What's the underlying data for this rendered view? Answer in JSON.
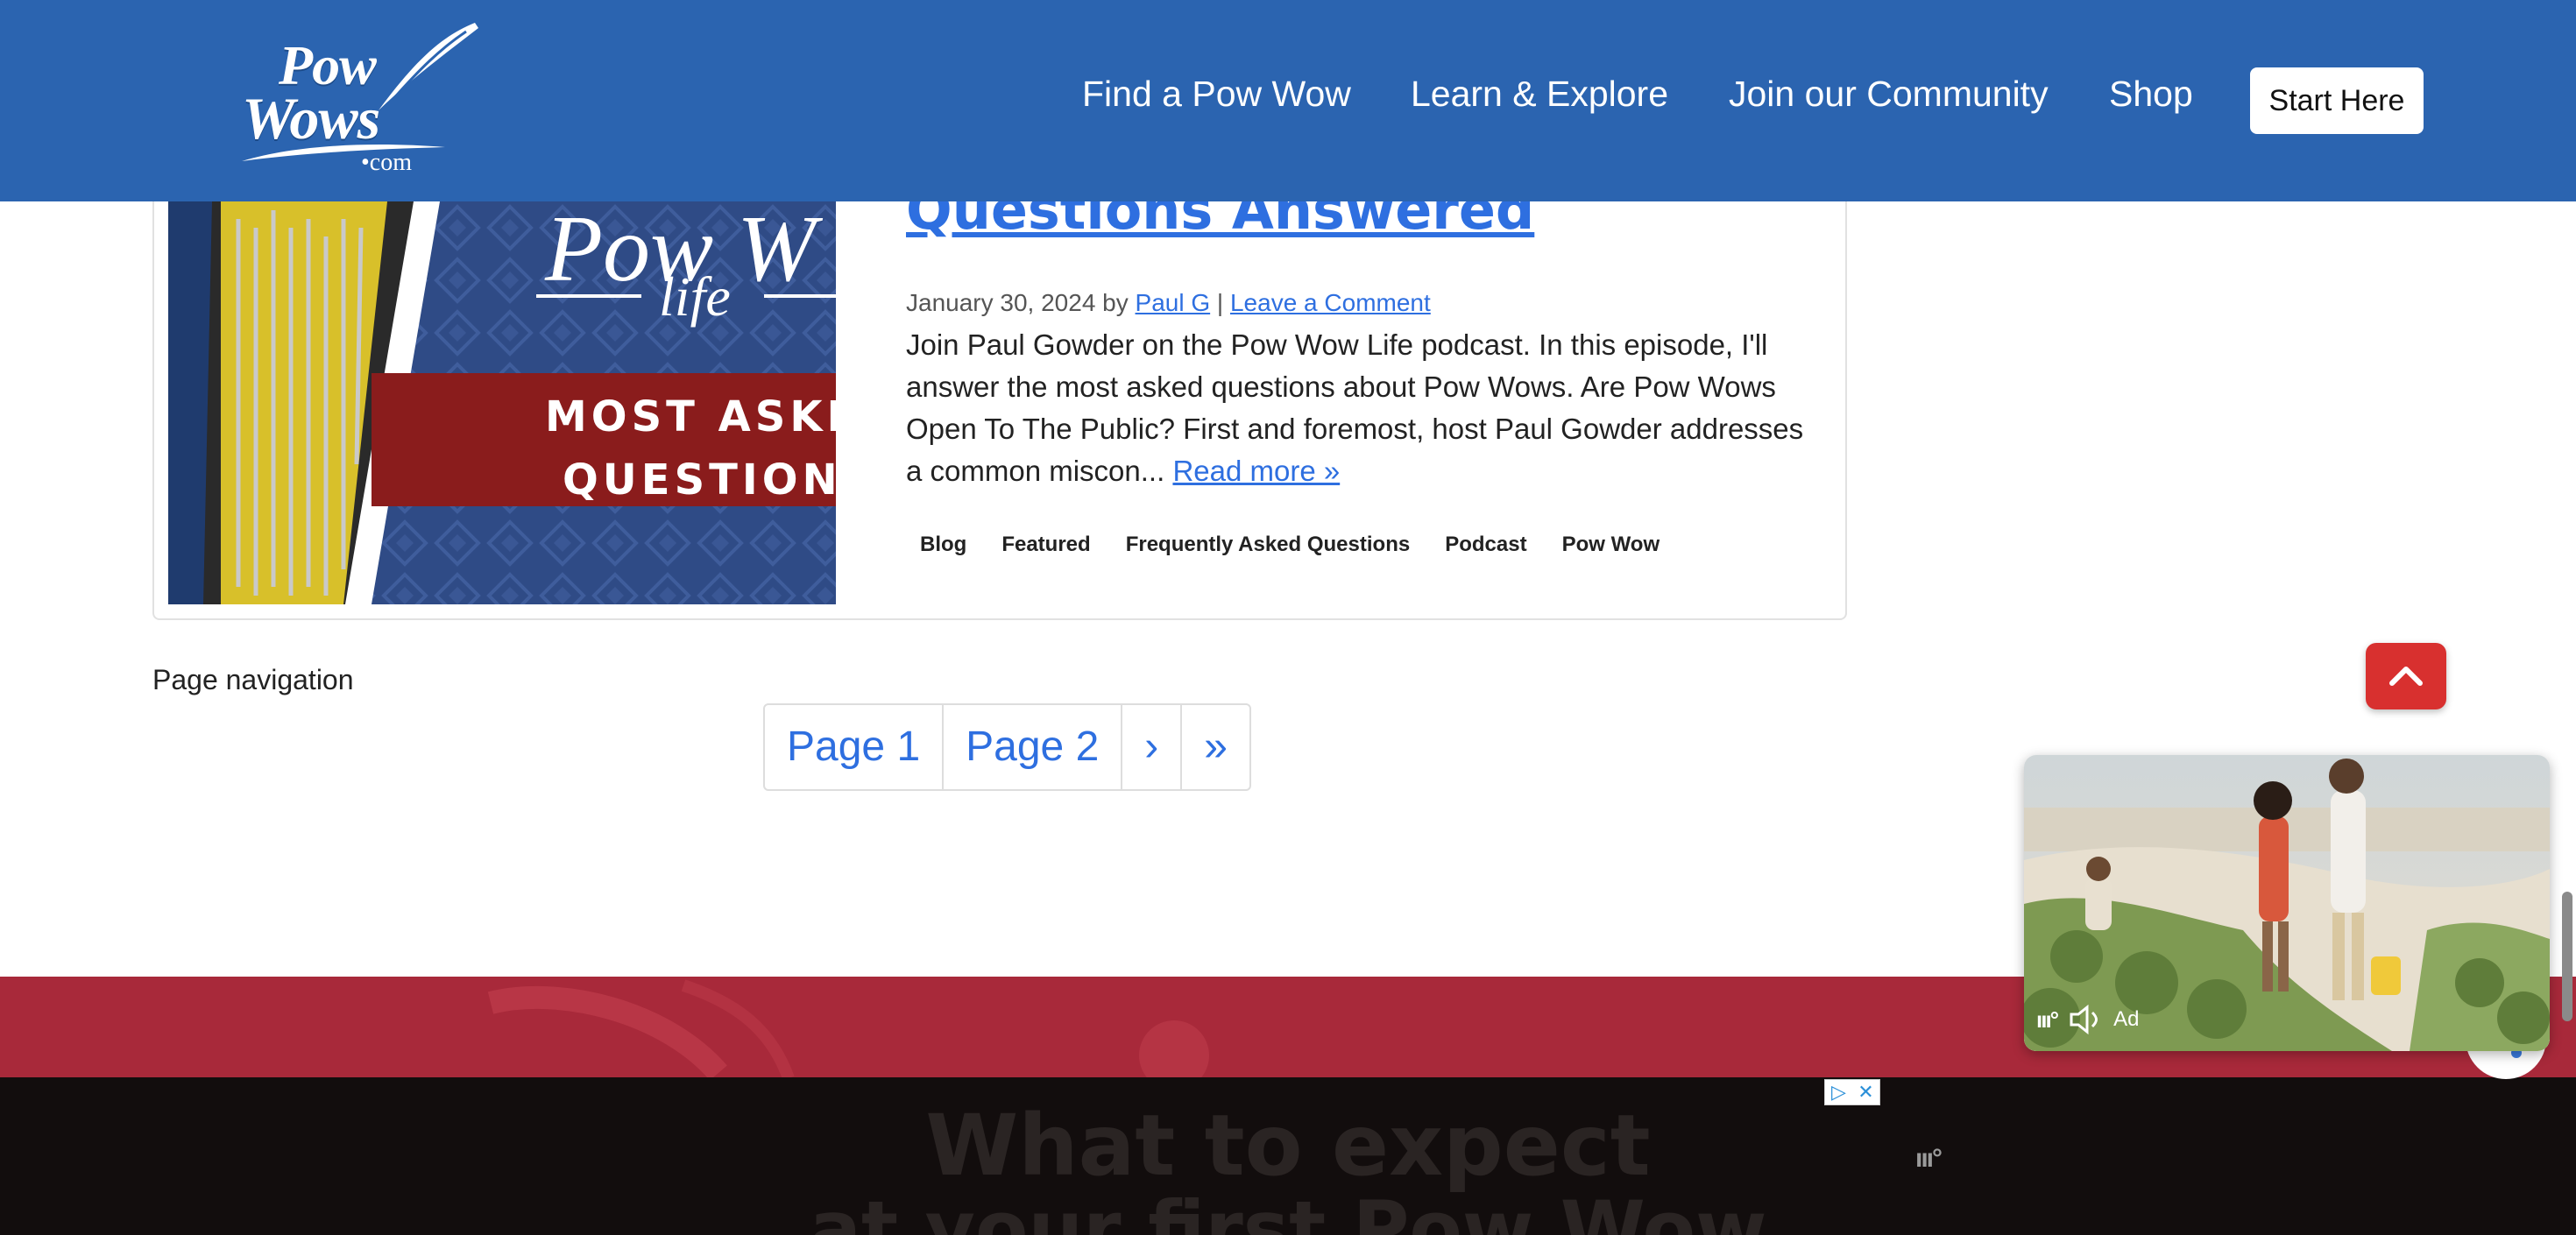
{
  "header": {
    "logo": {
      "line1": "Pow",
      "line2": "Wows",
      "line3": "•com"
    },
    "nav": [
      {
        "label": "Find a Pow Wow"
      },
      {
        "label": "Learn & Explore"
      },
      {
        "label": "Join our Community"
      },
      {
        "label": "Shop"
      }
    ],
    "start_button": "Start Here"
  },
  "post": {
    "title": "Questions Answered",
    "thumbnail": {
      "brand": "Pow W",
      "brand_sub": "life",
      "banner_line1": "MOST ASKE",
      "banner_line2": "QUESTION"
    },
    "date": "January 30, 2024",
    "by": "by",
    "author": "Paul G",
    "separator": "|",
    "comment_link": "Leave a Comment",
    "excerpt": "Join Paul Gowder on the Pow Wow Life podcast. In this episode, I'll answer the most asked questions about Pow Wows. Are Pow Wows Open To The Public? First and foremost, host Paul Gowder addresses a common miscon...",
    "read_more": "Read more »",
    "tags": [
      "Blog",
      "Featured",
      "Frequently Asked Questions",
      "Podcast",
      "Pow Wow"
    ]
  },
  "pagination": {
    "label": "Page navigation",
    "items": [
      "Page 1",
      "Page 2",
      "›",
      "»"
    ]
  },
  "footer": {
    "heading_line1": "What to expect",
    "heading_line2": "at your first Pow Wow"
  },
  "ads": {
    "video_ad_label": "Ad",
    "choices_play": "▷",
    "choices_close": "✕"
  },
  "colors": {
    "header_bg": "#2b64b0",
    "link": "#2e6fe0",
    "accent_red": "#d8302f",
    "footer_red": "#a8293a"
  }
}
